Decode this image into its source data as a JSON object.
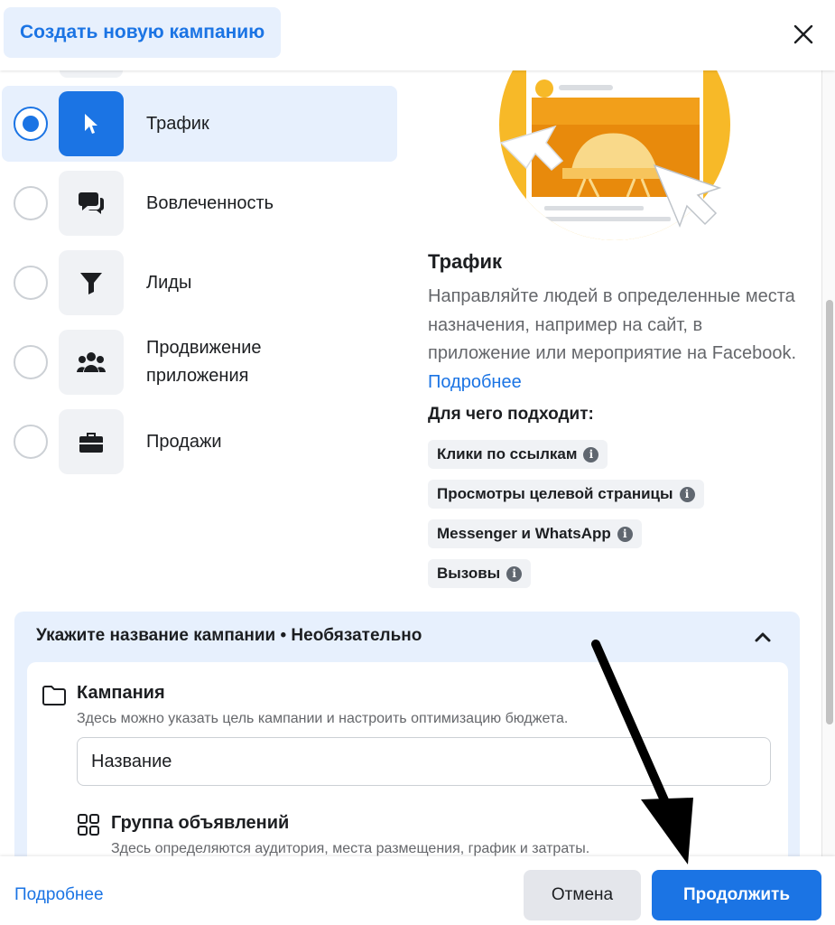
{
  "header": {
    "title": "Создать новую кампанию",
    "close_icon": "close-icon"
  },
  "objectives": [
    {
      "label": "Трафик",
      "selected": true,
      "icon": "cursor-icon"
    },
    {
      "label": "Вовлеченность",
      "selected": false,
      "icon": "chat-bubbles-icon"
    },
    {
      "label": "Лиды",
      "selected": false,
      "icon": "funnel-icon"
    },
    {
      "label": "Продвижение приложения",
      "selected": false,
      "icon": "people-icon"
    },
    {
      "label": "Продажи",
      "selected": false,
      "icon": "briefcase-icon"
    }
  ],
  "details": {
    "title": "Трафик",
    "description": "Направляйте людей в определенные места назначения, например на сайт, в приложение или мероприятие на Facebook.",
    "learn_more": "Подробнее",
    "suits_heading": "Для чего подходит:",
    "chips": [
      "Клики по ссылкам",
      "Просмотры целевой страницы",
      "Messenger и WhatsApp",
      "Вызовы"
    ]
  },
  "name_section": {
    "heading": "Укажите название кампании • Необязательно",
    "campaign_title": "Кампания",
    "campaign_sub": "Здесь можно указать цель кампании и настроить оптимизацию бюджета.",
    "name_value": "Название",
    "group_title": "Группа объявлений",
    "group_sub": "Здесь определяются аудитория, места размещения, график и затраты."
  },
  "footer": {
    "learn_more": "Подробнее",
    "cancel": "Отмена",
    "continue": "Продолжить"
  },
  "colors": {
    "accent": "#1b74e4",
    "accent_light": "#e7f0fd",
    "chip_bg": "#f0f2f5"
  }
}
